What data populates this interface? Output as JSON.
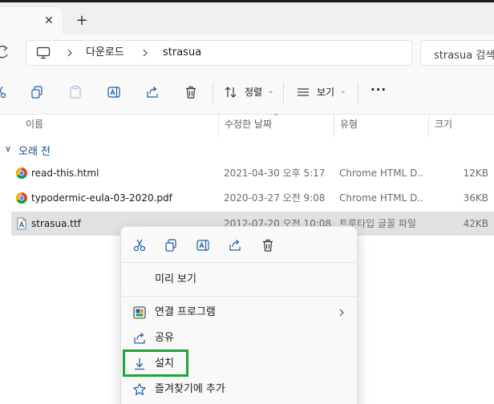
{
  "tabs": {
    "close_symbol": "✕",
    "new_tab_symbol": "+"
  },
  "address": {
    "breadcrumbs": [
      "다운로드",
      "strasua"
    ],
    "search_placeholder": "strasua 검색"
  },
  "toolbar": {
    "sort_label": "정렬",
    "view_label": "보기",
    "more_symbol": "···"
  },
  "columns": {
    "name": "이름",
    "date": "수정한 날짜",
    "type": "유형",
    "size": "크기"
  },
  "group": {
    "label": "오래 전"
  },
  "files": [
    {
      "name": "read-this.html",
      "date": "2021-04-30 오후 5:17",
      "type": "Chrome HTML D...",
      "size": "12KB",
      "icon": "chrome-icon"
    },
    {
      "name": "typodermic-eula-03-2020.pdf",
      "date": "2020-03-27 오전 9:08",
      "type": "Chrome HTML D...",
      "size": "36KB",
      "icon": "chrome-icon"
    },
    {
      "name": "strasua.ttf",
      "date": "2012-07-20 오전 10:08",
      "type": "트루타입 글꼴 파일",
      "size": "42KB",
      "icon": "font-file-icon",
      "selected": true
    }
  ],
  "context_menu": {
    "items": [
      {
        "label": "미리 보기"
      },
      {
        "label": "연결 프로그램"
      },
      {
        "label": "공유"
      },
      {
        "label": "설치"
      },
      {
        "label": "즐겨찾기에 추가"
      }
    ]
  },
  "colors": {
    "accent": "#0f4a84",
    "highlight": "#22a33a",
    "selection": "#e1e1e1"
  }
}
